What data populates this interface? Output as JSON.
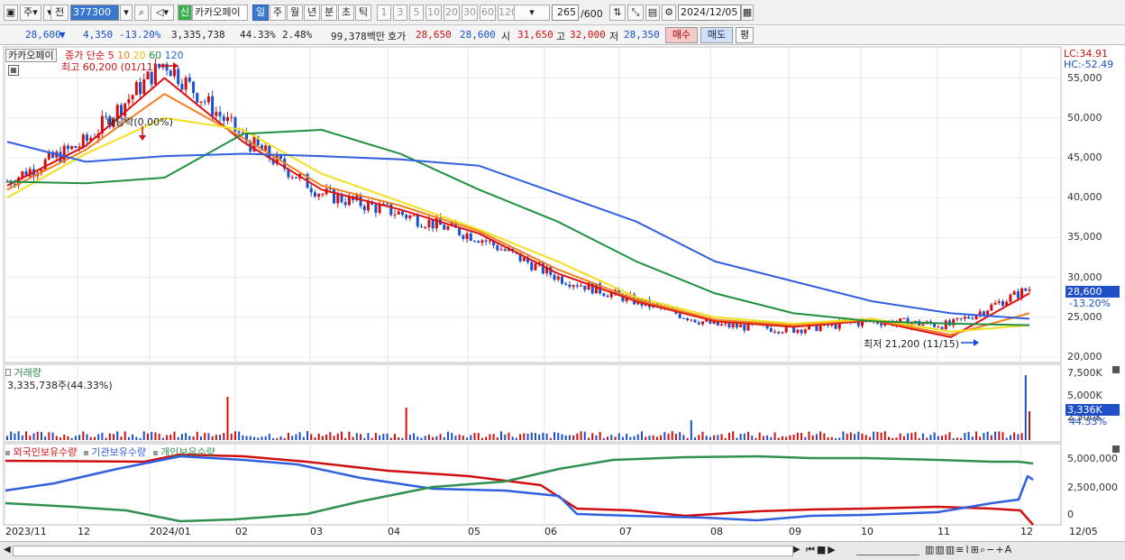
{
  "toolbar": {
    "mode1": "주",
    "mode2": "전",
    "code": "377300",
    "badge": "신",
    "name": "카카오페이",
    "periods": [
      "일",
      "주",
      "월",
      "년",
      "분",
      "초",
      "틱"
    ],
    "active_period": "일",
    "numbers": [
      "1",
      "3",
      "5",
      "10",
      "20",
      "30",
      "60",
      "120"
    ],
    "count": "265",
    "count_max": "/600",
    "date": "2024/12/05"
  },
  "quote": {
    "price": "28,600",
    "change": "4,350",
    "change_pct": "-13.20%",
    "volume": "3,335,738",
    "vol_ratio": "44.33%",
    "turnover": "2.48%",
    "amount": "99,378백만",
    "bid_label": "호가",
    "bid1": "28,650",
    "bid2": "28,600",
    "open_label": "시",
    "open": "31,650",
    "high_label": "고",
    "high": "32,000",
    "low_label": "저",
    "low": "28,350",
    "buy": "매수",
    "sell": "매도",
    "eval": "평"
  },
  "price_panel": {
    "stock_tag": "카카오페이",
    "ma_label": "종가 단순",
    "ma_periods": [
      "5",
      "10",
      "20",
      "60",
      "120"
    ],
    "high_note": "최고 60,200 (01/11)",
    "low_note": "최저 21,200 (11/15)",
    "dividend_note": "배당락(0.00%)",
    "lc": "LC:34.91",
    "hc": "HC:-52.49",
    "y_labels": [
      "55,000",
      "50,000",
      "45,000",
      "40,000",
      "35,000",
      "30,000",
      "25,000",
      "20,000"
    ],
    "last_price": "28,600",
    "last_pct": "-13.20%"
  },
  "volume_panel": {
    "title": "거래량",
    "info": "3,335,738주(44.33%)",
    "y_labels": [
      "7,500K",
      "5,000K",
      "2,500K"
    ],
    "last": "3,336K",
    "last_pct": "44.33%"
  },
  "holder_panel": {
    "series": [
      "외국인보유수량",
      "기관보유수량",
      "개인보유수량"
    ],
    "y_labels": [
      "5,000,000",
      "2,500,000",
      "0"
    ]
  },
  "x_labels": [
    "2023/11",
    "12",
    "2024/01",
    "02",
    "03",
    "04",
    "05",
    "06",
    "07",
    "08",
    "09",
    "10",
    "11",
    "12",
    "12/05"
  ],
  "colors": {
    "up": "#d01010",
    "down": "#1a4fd0",
    "ma5": "#e01010",
    "ma10": "#f08020",
    "ma20": "#f0e020",
    "ma60": "#209040",
    "ma120": "#3060e0",
    "foreign": "#d01010",
    "inst": "#3060e0",
    "retail": "#309050"
  },
  "chart_data": {
    "type": "line",
    "ylim": [
      20000,
      58000
    ],
    "categories": [
      "2023/11",
      "12",
      "2024/01",
      "02",
      "03",
      "04",
      "05",
      "06",
      "07",
      "08",
      "09",
      "10",
      "11",
      "12"
    ],
    "close": [
      42000,
      47000,
      57000,
      47500,
      40500,
      38000,
      35000,
      30000,
      27000,
      24000,
      23500,
      24500,
      24000,
      28600
    ],
    "series": [
      {
        "name": "5",
        "values": [
          41500,
          46500,
          55000,
          47000,
          41000,
          38500,
          35500,
          30500,
          27000,
          24500,
          23800,
          24600,
          22500,
          28000
        ]
      },
      {
        "name": "10",
        "values": [
          41000,
          46000,
          53000,
          47500,
          41500,
          39000,
          35800,
          31000,
          27200,
          24700,
          24000,
          24700,
          22800,
          25500
        ]
      },
      {
        "name": "20",
        "values": [
          40000,
          45500,
          50000,
          48500,
          43000,
          39500,
          36000,
          32000,
          27500,
          25000,
          24200,
          24800,
          23200,
          24000
        ]
      },
      {
        "name": "60",
        "values": [
          42000,
          41800,
          42500,
          48000,
          48500,
          45500,
          41000,
          37000,
          32000,
          28000,
          25500,
          24500,
          24200,
          24000
        ]
      },
      {
        "name": "120",
        "values": [
          47000,
          44500,
          45200,
          45500,
          45200,
          44800,
          44000,
          40500,
          37000,
          32000,
          29500,
          27000,
          25500,
          24800
        ]
      }
    ]
  }
}
